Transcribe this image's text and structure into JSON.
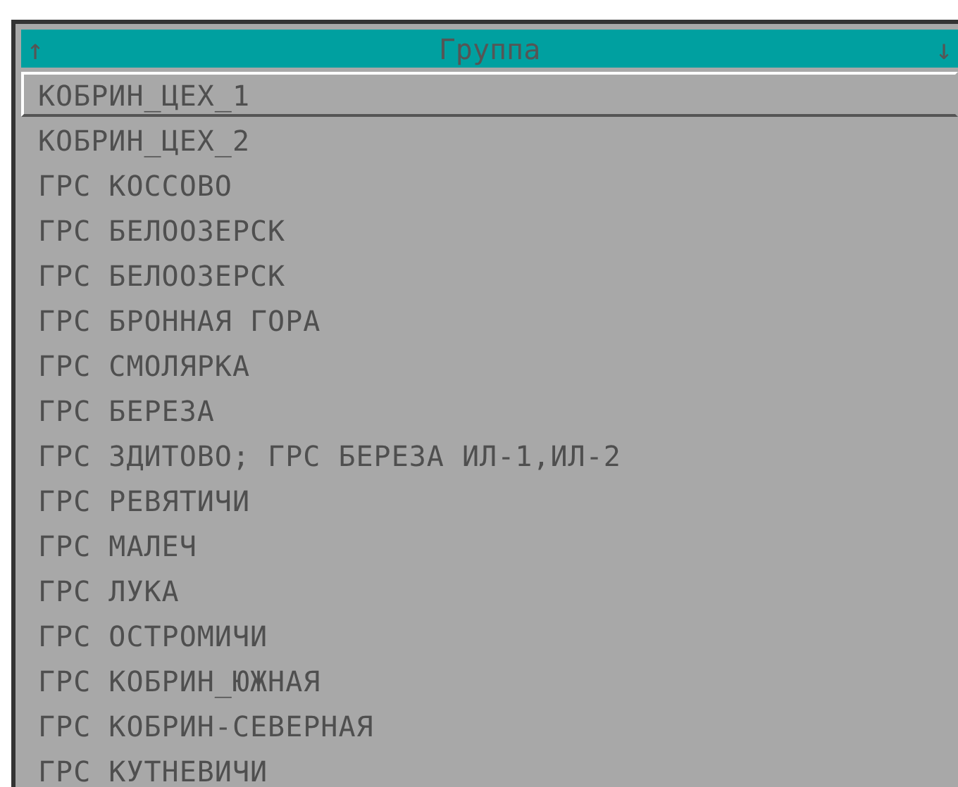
{
  "header": {
    "title": "Группа",
    "scroll_up": "↑",
    "scroll_down": "↓"
  },
  "rows": [
    {
      "label": "КОБРИН_ЦЕХ_1",
      "selected": true
    },
    {
      "label": "КОБРИН_ЦЕХ_2",
      "selected": false
    },
    {
      "label": "ГРС КОССОВО",
      "selected": false
    },
    {
      "label": "ГРС БЕЛООЗЕРСК",
      "selected": false
    },
    {
      "label": "ГРС БЕЛООЗЕРСК",
      "selected": false
    },
    {
      "label": "ГРС БРОННАЯ ГОРА",
      "selected": false
    },
    {
      "label": "ГРС СМОЛЯРКА",
      "selected": false
    },
    {
      "label": "ГРС БЕРЕЗА",
      "selected": false
    },
    {
      "label": "ГРС ЗДИТОВО; ГРС БЕРЕЗА ИЛ-1,ИЛ-2",
      "selected": false
    },
    {
      "label": "ГРС РЕВЯТИЧИ",
      "selected": false
    },
    {
      "label": "ГРС МАЛЕЧ",
      "selected": false
    },
    {
      "label": "ГРС ЛУКА",
      "selected": false
    },
    {
      "label": "ГРС ОСТРОМИЧИ",
      "selected": false
    },
    {
      "label": "ГРС КОБРИН_ЮЖНАЯ",
      "selected": false
    },
    {
      "label": "ГРС КОБРИН-СЕВЕРНАЯ",
      "selected": false
    },
    {
      "label": "ГРС КУТНЕВИЧИ",
      "selected": false
    }
  ]
}
